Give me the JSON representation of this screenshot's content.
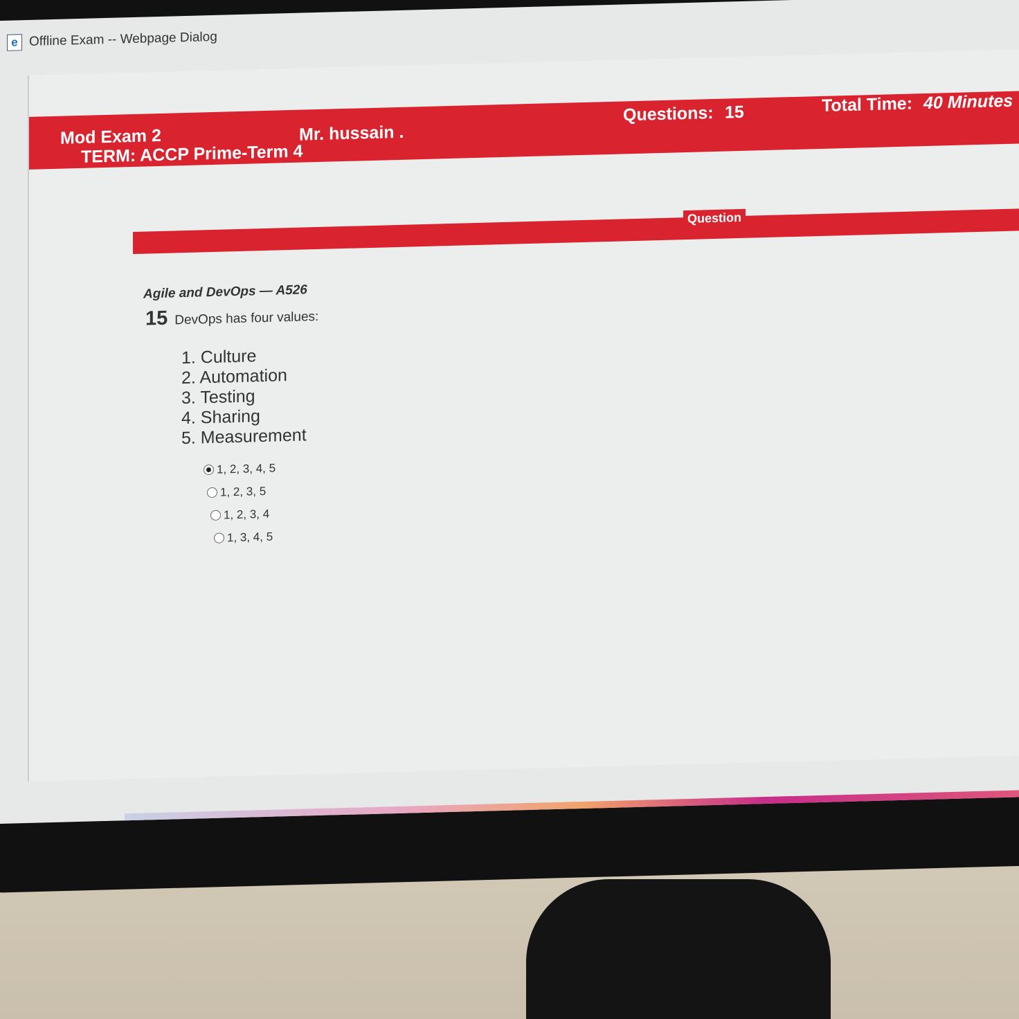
{
  "window": {
    "title": "Offline Exam -- Webpage Dialog"
  },
  "header": {
    "exam_name": "Mod Exam 2",
    "term": "TERM: ACCP Prime-Term 4",
    "instructor": "Mr. hussain .",
    "questions_label": "Questions:",
    "questions_count": "15",
    "time_label": "Total Time:",
    "time_value": "40 Minutes"
  },
  "question_bar": {
    "label": "Question"
  },
  "question": {
    "subject": "Agile and DevOps — A526",
    "number": "15",
    "text": "DevOps has four values:",
    "items": [
      "1. Culture",
      "2. Automation",
      "3. Testing",
      "4. Sharing",
      "5. Measurement"
    ],
    "options": [
      {
        "label": "1, 2, 3, 4, 5",
        "selected": true
      },
      {
        "label": "1, 2, 3, 5",
        "selected": false
      },
      {
        "label": "1, 2, 3, 4",
        "selected": false
      },
      {
        "label": "1, 3, 4, 5",
        "selected": false
      }
    ]
  },
  "colors": {
    "accent": "#d9232f"
  }
}
